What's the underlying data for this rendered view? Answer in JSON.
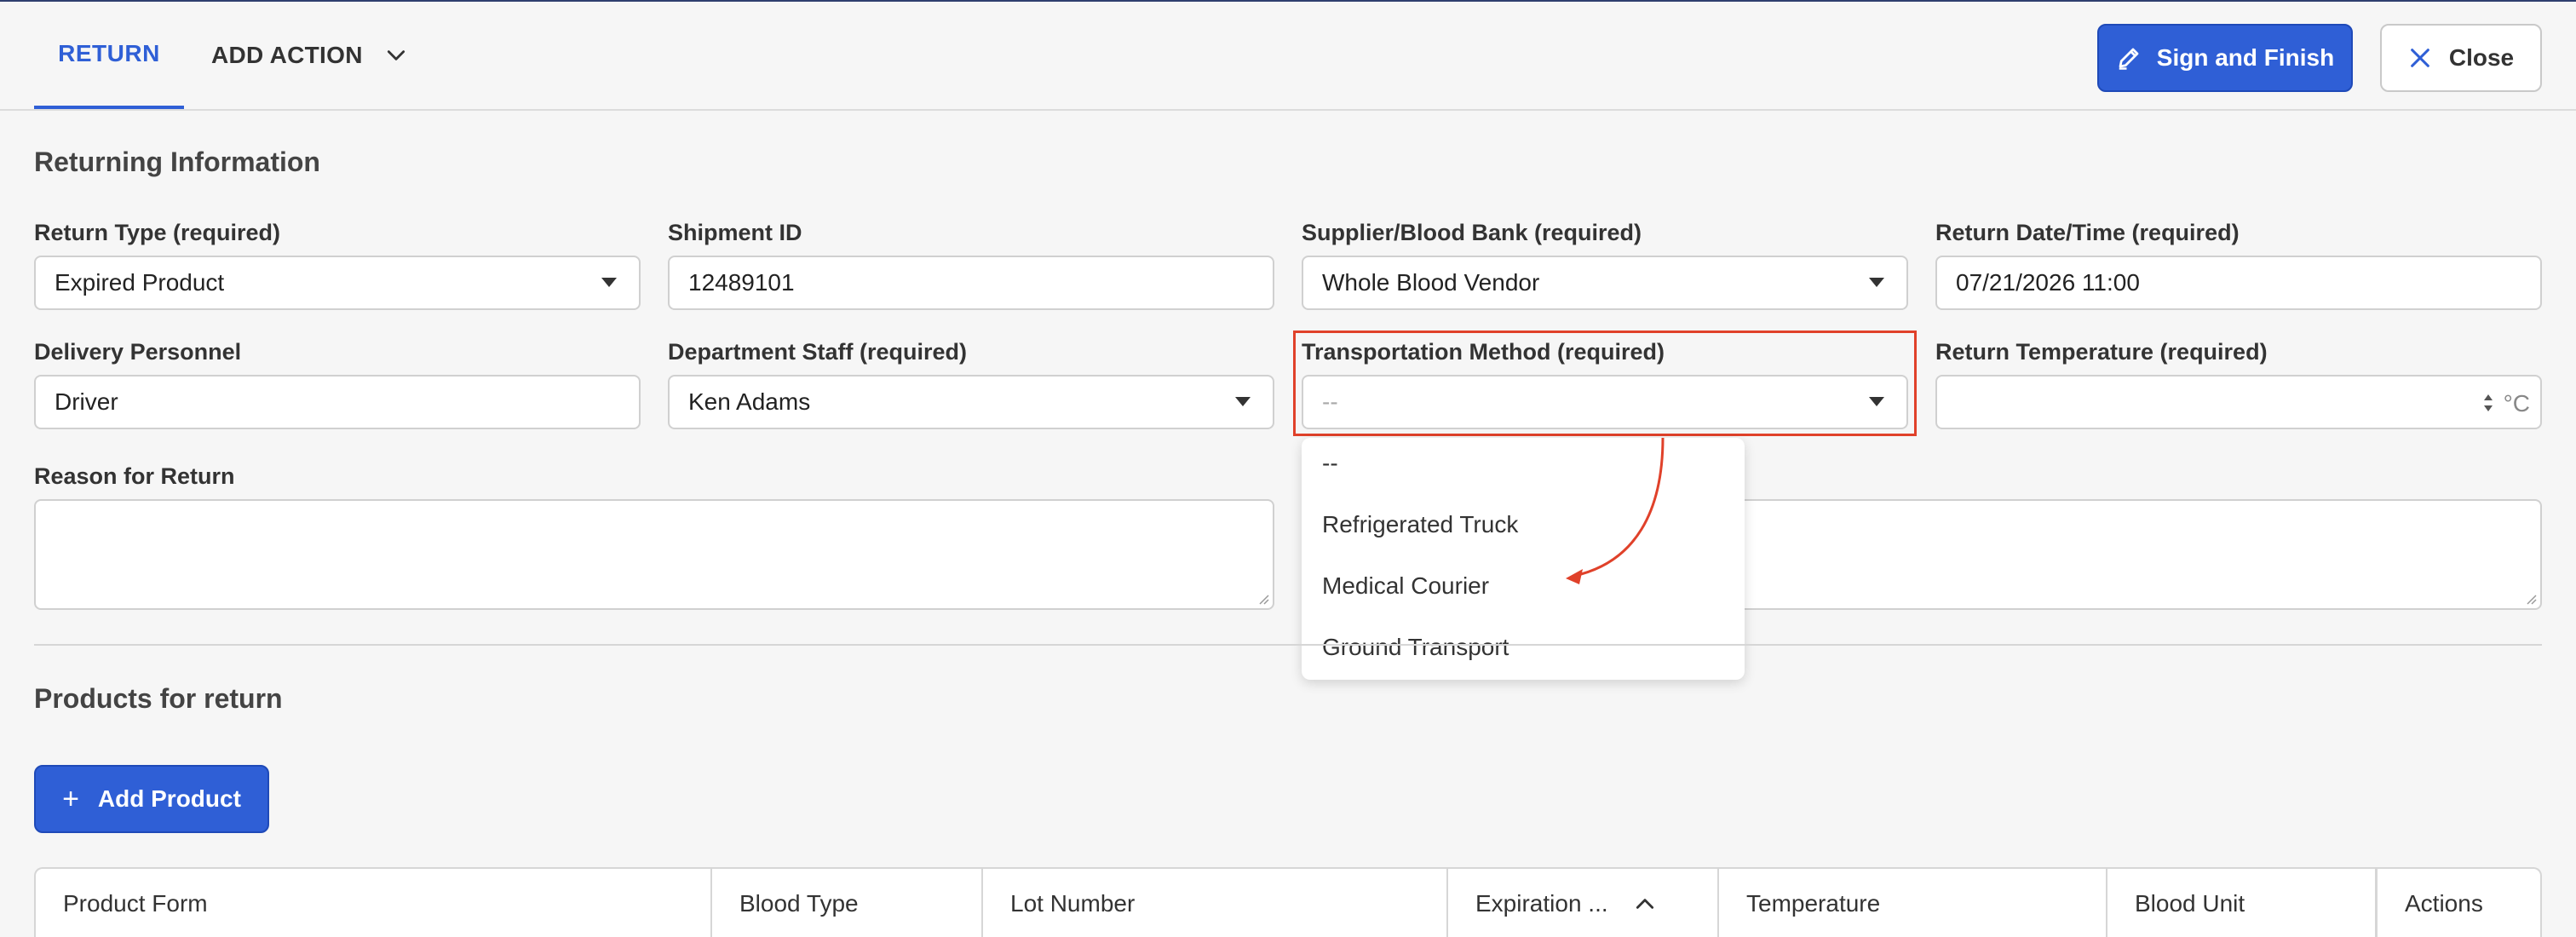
{
  "header": {
    "tab_return": "RETURN",
    "tab_add_action": "ADD ACTION",
    "sign_button": "Sign and Finish",
    "close_button": "Close"
  },
  "colors": {
    "accent": "#2f5fd6",
    "highlight": "#e0412a"
  },
  "returning_information": {
    "title": "Returning Information",
    "return_type": {
      "label": "Return Type (required)",
      "value": "Expired Product"
    },
    "shipment_id": {
      "label": "Shipment ID",
      "value": "12489101"
    },
    "supplier": {
      "label": "Supplier/Blood Bank (required)",
      "value": "Whole Blood Vendor"
    },
    "return_datetime": {
      "label": "Return Date/Time (required)",
      "value": "07/21/2026 11:00"
    },
    "delivery_personnel": {
      "label": "Delivery Personnel",
      "value": "Driver"
    },
    "department_staff": {
      "label": "Department Staff (required)",
      "value": "Ken Adams"
    },
    "transportation_method": {
      "label": "Transportation Method (required)",
      "value": "--",
      "options": [
        "--",
        "Refrigerated Truck",
        "Medical Courier",
        "Ground Transport"
      ]
    },
    "return_temperature": {
      "label": "Return Temperature (required)",
      "unit": "°C"
    },
    "reason": {
      "label": "Reason for Return"
    }
  },
  "products": {
    "title": "Products for return",
    "add_button": "Add Product",
    "columns": [
      "Product Form",
      "Blood Type",
      "Lot Number",
      "Expiration ...",
      "Temperature",
      "Blood Unit",
      "Actions"
    ]
  }
}
